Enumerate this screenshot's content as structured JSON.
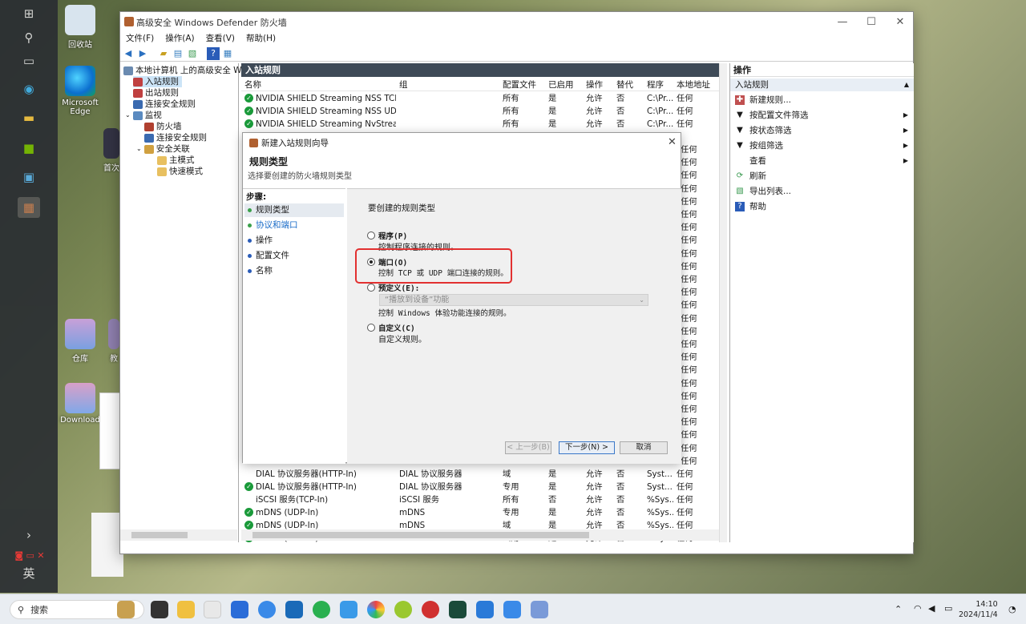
{
  "desktop": {
    "icons": [
      {
        "label": "回收站"
      },
      {
        "label": "Microsoft Edge"
      },
      {
        "label": "首次"
      },
      {
        "label": "仓库"
      },
      {
        "label": "教"
      },
      {
        "label": "Download"
      }
    ],
    "lang": "英"
  },
  "window": {
    "title": "高级安全 Windows Defender 防火墙",
    "menu": [
      "文件(F)",
      "操作(A)",
      "查看(V)",
      "帮助(H)"
    ]
  },
  "tree": {
    "root": "本地计算机 上的高级安全 Windo",
    "items": [
      "入站规则",
      "出站规则",
      "连接安全规则",
      "监视",
      "防火墙",
      "连接安全规则",
      "安全关联",
      "主模式",
      "快速模式"
    ]
  },
  "list": {
    "header": "入站规则",
    "columns": [
      "名称",
      "组",
      "配置文件",
      "已启用",
      "操作",
      "替代",
      "程序",
      "本地地址"
    ],
    "top_rows": [
      {
        "name": "NVIDIA SHIELD Streaming NSS TCP Exc...",
        "group": "",
        "profile": "所有",
        "enabled": "是",
        "action": "允许",
        "override": "否",
        "program": "C:\\Pr...",
        "local": "任何"
      },
      {
        "name": "NVIDIA SHIELD Streaming NSS UDP Ex...",
        "group": "",
        "profile": "所有",
        "enabled": "是",
        "action": "允许",
        "override": "否",
        "program": "C:\\Pr...",
        "local": "任何"
      },
      {
        "name": "NVIDIA SHIELD Streaming NvStreamer ...",
        "group": "",
        "profile": "所有",
        "enabled": "是",
        "action": "允许",
        "override": "否",
        "program": "C:\\Pr...",
        "local": "任何"
      }
    ],
    "bottom_rows": [
      {
        "name": "DIAL 协议服务器(HTTP-In)",
        "group": "DIAL 协议服务器",
        "profile": "域",
        "enabled": "是",
        "action": "允许",
        "override": "否",
        "program": "Syst...",
        "local": "任何"
      },
      {
        "name": "DIAL 协议服务器(HTTP-In)",
        "group": "DIAL 协议服务器",
        "profile": "专用",
        "enabled": "是",
        "action": "允许",
        "override": "否",
        "program": "Syst...",
        "local": "任何"
      },
      {
        "name": "iSCSI 服务(TCP-In)",
        "group": "iSCSI 服务",
        "profile": "所有",
        "enabled": "否",
        "action": "允许",
        "override": "否",
        "program": "%Sys...",
        "local": "任何"
      },
      {
        "name": "mDNS (UDP-In)",
        "group": "mDNS",
        "profile": "专用",
        "enabled": "是",
        "action": "允许",
        "override": "否",
        "program": "%Sys...",
        "local": "任何"
      },
      {
        "name": "mDNS (UDP-In)",
        "group": "mDNS",
        "profile": "域",
        "enabled": "是",
        "action": "允许",
        "override": "否",
        "program": "%Sys...",
        "local": "任何"
      },
      {
        "name": "mDNS (UDP-In)",
        "group": "mDNS",
        "profile": "公用",
        "enabled": "是",
        "action": "允许",
        "override": "否",
        "program": "%Sys...",
        "local": "任何"
      }
    ],
    "hidden_local": "任何"
  },
  "actions": {
    "header": "操作",
    "section": "入站规则",
    "items": [
      "新建规则...",
      "按配置文件筛选",
      "按状态筛选",
      "按组筛选",
      "查看",
      "刷新",
      "导出列表...",
      "帮助"
    ]
  },
  "wizard": {
    "title": "新建入站规则向导",
    "heading": "规则类型",
    "subheading": "选择要创建的防火墙规则类型",
    "steps_header": "步骤:",
    "steps": [
      "规则类型",
      "协议和端口",
      "操作",
      "配置文件",
      "名称"
    ],
    "prompt": "要创建的规则类型",
    "options": [
      {
        "label": "程序(P)",
        "desc": "控制程序连接的规则。"
      },
      {
        "label": "端口(O)",
        "desc": "控制 TCP 或 UDP 端口连接的规则。"
      },
      {
        "label": "预定义(E):",
        "desc": "控制 Windows 体验功能连接的规则。"
      },
      {
        "label": "自定义(C)",
        "desc": "自定义规则。"
      }
    ],
    "predefined_value": "“播放到设备”功能",
    "btn_back": "< 上一步(B)",
    "btn_next": "下一步(N) >",
    "btn_cancel": "取消"
  },
  "taskbar": {
    "search": "搜索",
    "time": "14:10",
    "date": "2024/11/4"
  }
}
